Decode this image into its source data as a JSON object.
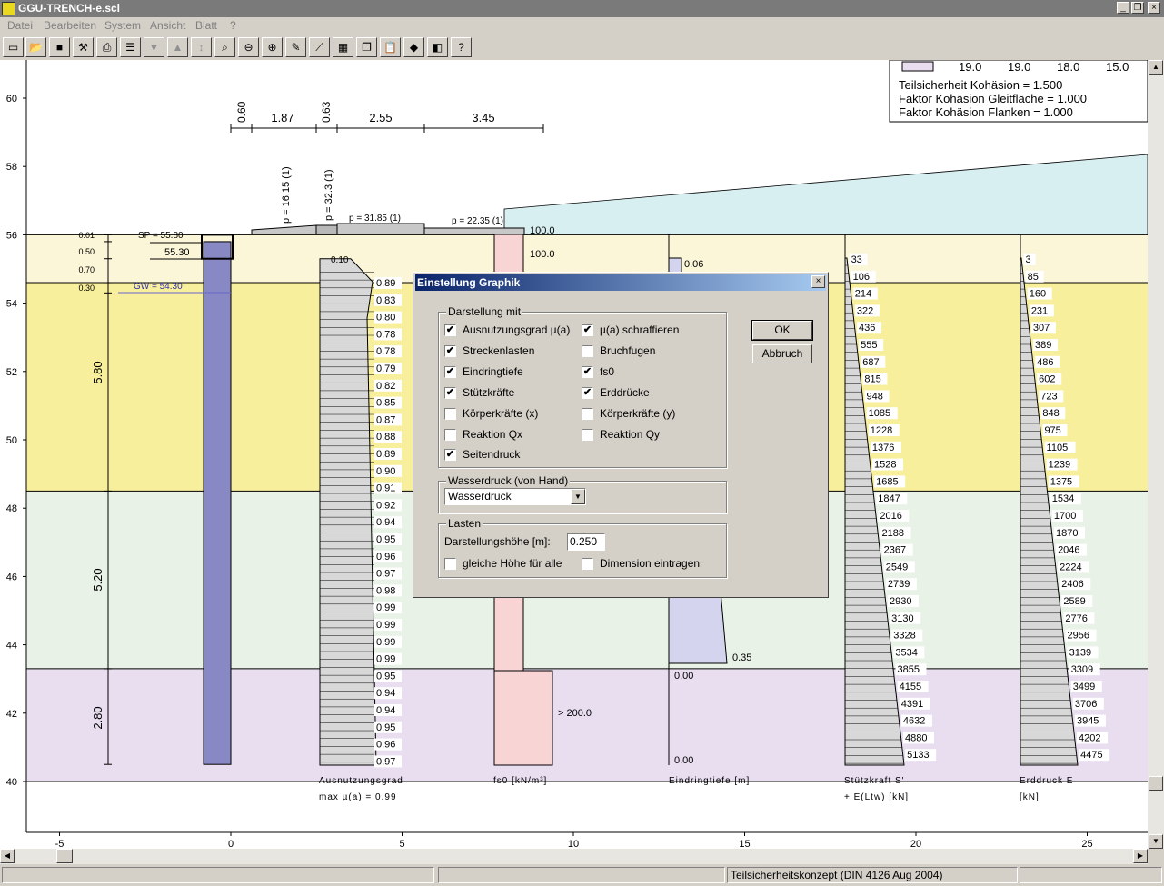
{
  "window": {
    "title": "GGU-TRENCH-e.scl"
  },
  "menu": [
    "Datei",
    "Bearbeiten",
    "System",
    "Ansicht",
    "Blatt",
    "?"
  ],
  "toolbar": [
    "new",
    "open",
    "save",
    "tools",
    "print",
    "page",
    "arrow-down",
    "arrow-up",
    "arrow-updown",
    "zoom-page",
    "zoom-out",
    "zoom-in",
    "edit",
    "edit2",
    "grid",
    "copy",
    "paste",
    "palette",
    "color",
    "help"
  ],
  "legend": {
    "row": [
      "19.0",
      "19.0",
      "18.0",
      "15.0"
    ],
    "lines": [
      "Teilsicherheit Kohäsion = 1.500",
      "Faktor Kohäsion Gleitfläche = 1.000",
      "Faktor Kohäsion Flanken = 1.000"
    ]
  },
  "axis": {
    "y_ticks": [
      "60",
      "58",
      "56",
      "54",
      "52",
      "50",
      "48",
      "46",
      "44",
      "42",
      "40"
    ],
    "x_ticks": [
      "-5",
      "0",
      "5",
      "10",
      "15",
      "20",
      "25"
    ]
  },
  "dims": {
    "top": [
      "0.60",
      "1.87",
      "0.63",
      "2.55",
      "3.45"
    ],
    "left": [
      "5.80",
      "5.20",
      "2.80"
    ]
  },
  "levels": {
    "sp": "SP = 55.80",
    "sp2": "55.30",
    "gw": "GW = 54.30",
    "small": [
      "0.01",
      "0.50",
      "0.70",
      "0.30"
    ]
  },
  "loads": [
    "p = 16.15 (1)",
    "p = 32.3 (1)",
    "p = 31.85 (1)",
    "p = 22.35 (1)"
  ],
  "util": {
    "values": [
      "0.89",
      "0.83",
      "0.80",
      "0.78",
      "0.78",
      "0.79",
      "0.82",
      "0.85",
      "0.87",
      "0.88",
      "0.89",
      "0.90",
      "0.91",
      "0.92",
      "0.94",
      "0.95",
      "0.96",
      "0.97",
      "0.98",
      "0.99",
      "0.99",
      "0.99",
      "0.99",
      "0.95",
      "0.94",
      "0.94",
      "0.95",
      "0.96",
      "0.97"
    ],
    "top": "0.10",
    "label": "Ausnutzungsgrad",
    "max": "max µ(a) = 0.99"
  },
  "fs0": {
    "v1": "100.0",
    "v2": "100.0",
    "v3": "> 200.0",
    "label": "fs0 [kN/m³]"
  },
  "eindring": {
    "v1": "0.06",
    "v2": "0.35",
    "v3": "0.00",
    "v4": "0.00",
    "label": "Eindringtiefe [m]"
  },
  "stuetz": {
    "values": [
      "33",
      "106",
      "214",
      "322",
      "436",
      "555",
      "687",
      "815",
      "948",
      "1085",
      "1228",
      "1376",
      "1528",
      "1685",
      "1847",
      "2016",
      "2188",
      "2367",
      "2549",
      "2739",
      "2930",
      "3130",
      "3328",
      "3534",
      "3855",
      "4155",
      "4391",
      "4632",
      "4880",
      "5133"
    ],
    "label": "Stützkraft S'",
    "label2": "+ E(Ltw) [kN]"
  },
  "erd": {
    "values": [
      "3",
      "85",
      "160",
      "231",
      "307",
      "389",
      "486",
      "602",
      "723",
      "848",
      "975",
      "1105",
      "1239",
      "1375",
      "1534",
      "1700",
      "1870",
      "2046",
      "2224",
      "2406",
      "2589",
      "2776",
      "2956",
      "3139",
      "3309",
      "3499",
      "3706",
      "3945",
      "4202",
      "4475"
    ],
    "label": "Erddruck E",
    "label2": "[kN]"
  },
  "dialog": {
    "title": "Einstellung Graphik",
    "group1": "Darstellung mit",
    "checks_left": [
      {
        "label": "Ausnutzungsgrad µ(a)",
        "checked": "✔"
      },
      {
        "label": "Streckenlasten",
        "checked": "✔"
      },
      {
        "label": "Eindringtiefe",
        "checked": "✔"
      },
      {
        "label": "Stützkräfte",
        "checked": "✔"
      },
      {
        "label": "Körperkräfte (x)",
        "checked": ""
      },
      {
        "label": "Reaktion Qx",
        "checked": ""
      },
      {
        "label": "Seitendruck",
        "checked": "✔"
      }
    ],
    "checks_right": [
      {
        "label": "µ(a) schraffieren",
        "checked": "✔"
      },
      {
        "label": "Bruchfugen",
        "checked": ""
      },
      {
        "label": "fs0",
        "checked": "✔"
      },
      {
        "label": "Erddrücke",
        "checked": "✔"
      },
      {
        "label": "Körperkräfte (y)",
        "checked": ""
      },
      {
        "label": "Reaktion Qy",
        "checked": ""
      }
    ],
    "ok": "OK",
    "cancel": "Abbruch",
    "group2": "Wasserdruck (von Hand)",
    "water_value": "Wasserdruck",
    "group3": "Lasten",
    "height_label": "Darstellungshöhe [m]:",
    "height_value": "0.250",
    "same_height": "gleiche Höhe für alle",
    "dimension": "Dimension eintragen"
  },
  "status": {
    "text": "Teilsicherheitskonzept (DIN 4126 Aug 2004)"
  },
  "colors": {
    "layer1": "#fbf6d8",
    "layer2": "#f8ef9c",
    "layer3": "#e8f2e6",
    "layer4": "#e8def0",
    "wall": "#8888c4",
    "sky": "#d8eff2",
    "fs0": "#f8d4d4",
    "eind": "#d4d4ee"
  }
}
